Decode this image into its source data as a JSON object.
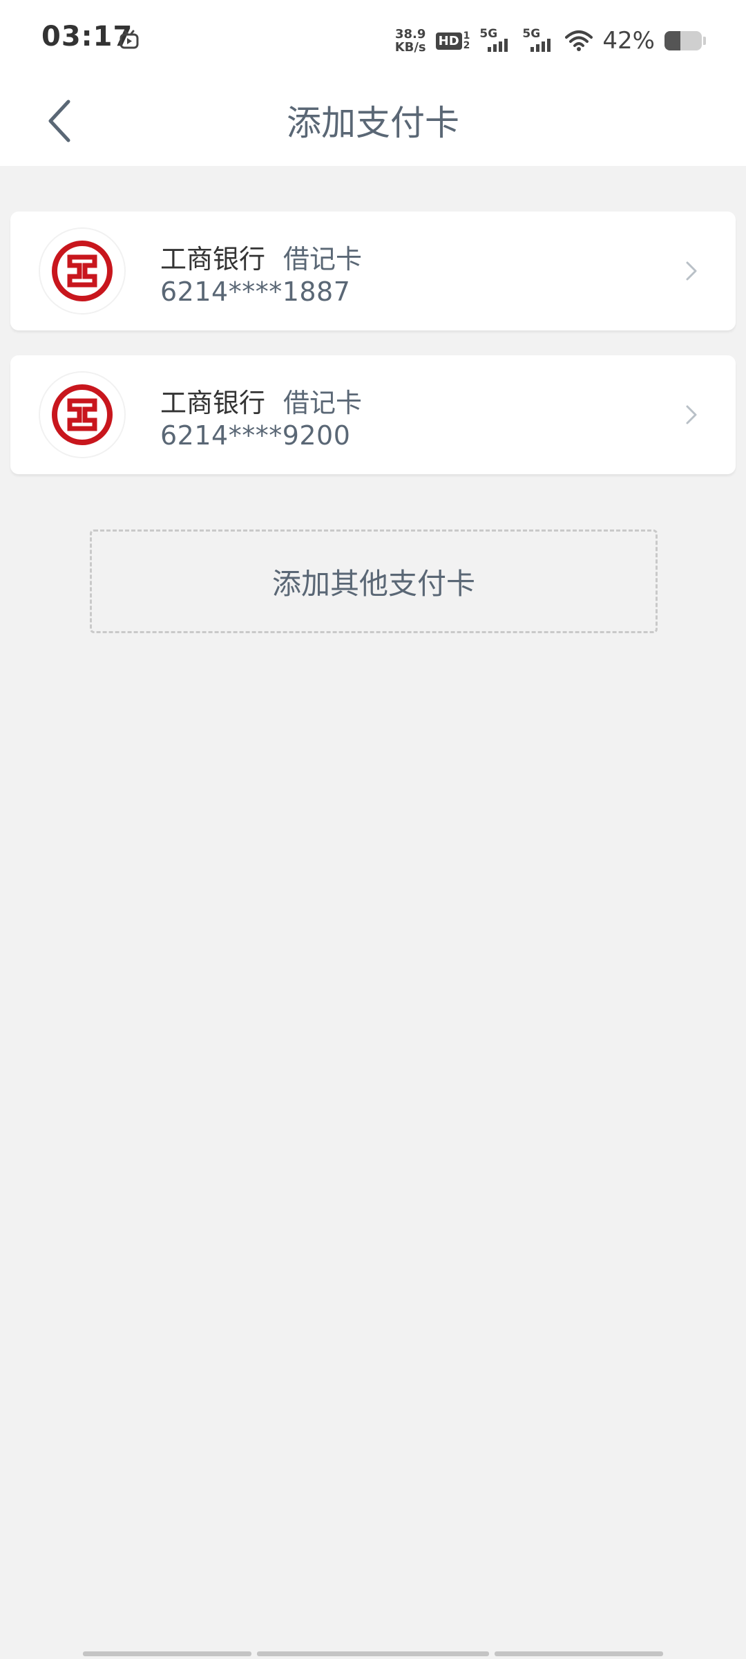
{
  "status_bar": {
    "time": "03:17",
    "net_speed_value": "38.9",
    "net_speed_unit": "KB/s",
    "hd_label": "HD",
    "hd_sub_top": "1",
    "hd_sub_bottom": "2",
    "signal1_label": "5G",
    "signal2_label": "5G",
    "battery_percent": "42%",
    "battery_level": 0.42,
    "icons": [
      "tv-app-icon",
      "hd-voice-icon",
      "signal-icon",
      "wifi-icon",
      "battery-icon"
    ]
  },
  "header": {
    "title": "添加支付卡",
    "back_icon": "chevron-left-icon"
  },
  "cards": [
    {
      "bank_name": "工商银行",
      "card_type": "借记卡",
      "card_number": "6214****1887",
      "logo": "icbc-logo"
    },
    {
      "bank_name": "工商银行",
      "card_type": "借记卡",
      "card_number": "6214****9200",
      "logo": "icbc-logo"
    }
  ],
  "add_card_button": {
    "label": "添加其他支付卡"
  },
  "colors": {
    "background": "#f2f2f2",
    "surface": "#ffffff",
    "title_text": "#5a6775",
    "primary_text": "#333333",
    "icbc_red": "#c8161d",
    "dashed_border": "#c9c9c9"
  }
}
